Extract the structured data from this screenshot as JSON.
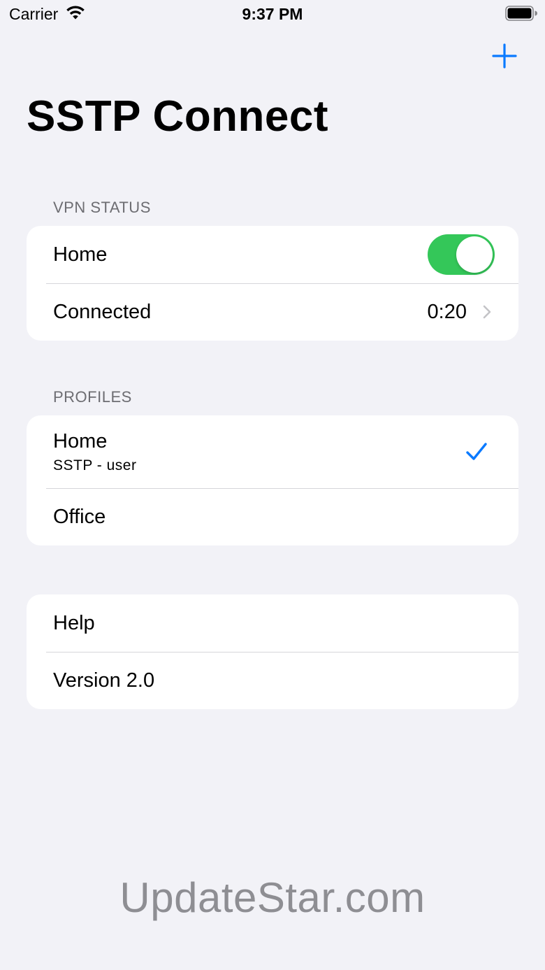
{
  "status_bar": {
    "carrier": "Carrier",
    "time": "9:37 PM",
    "wifi_icon": "wifi-icon",
    "battery_icon": "battery-icon"
  },
  "nav": {
    "add_icon": "plus-icon",
    "title": "SSTP Connect"
  },
  "vpn_status": {
    "header": "VPN STATUS",
    "profile_name": "Home",
    "toggle_on": true,
    "status_label": "Connected",
    "duration": "0:20"
  },
  "profiles": {
    "header": "PROFILES",
    "items": [
      {
        "name": "Home",
        "detail": "SSTP - user",
        "selected": true
      },
      {
        "name": "Office",
        "selected": false
      }
    ]
  },
  "about": {
    "help_label": "Help",
    "version_label": "Version 2.0"
  },
  "watermark": "UpdateStar.com",
  "colors": {
    "accent": "#0a7aff",
    "toggle_on": "#34c759",
    "background": "#f2f2f7",
    "secondary_text": "#6d6d72"
  }
}
